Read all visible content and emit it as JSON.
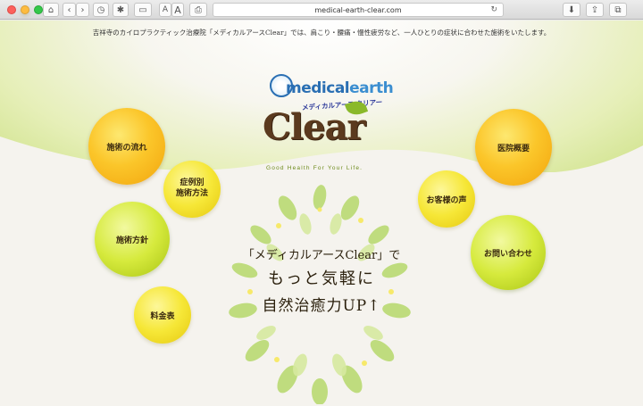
{
  "browser": {
    "url": "medical-earth-clear.com",
    "font_small": "A",
    "font_large": "A"
  },
  "page": {
    "tagline": "吉祥寺のカイロプラクティック治療院「メディカルアースClear」では、肩こり・腰痛・慢性疲労など、一人ひとりの症状に合わせた施術をいたします。",
    "logo": {
      "top_medical": "medical",
      "top_earth": "earth",
      "kana": "メディカルアース クリアー",
      "clear": "Clear",
      "sub": "Good Health For Your Life."
    },
    "nav": {
      "flow": "施術の流れ",
      "cases_1": "症例別",
      "cases_2": "施術方法",
      "policy": "施術方針",
      "price": "料金表",
      "about": "医院概要",
      "voice": "お客様の声",
      "contact": "お問い合わせ"
    },
    "headline": {
      "line1": "「メディカルアースClear」で",
      "line2": "もっと気軽に",
      "line3": "自然治癒力UP↑"
    }
  },
  "colors": {
    "orange": "#fbc62a",
    "yellow": "#f6e737",
    "lime": "#d6ea3d",
    "brand_brown": "#5b3a1e",
    "brand_blue": "#2a6fb3"
  }
}
